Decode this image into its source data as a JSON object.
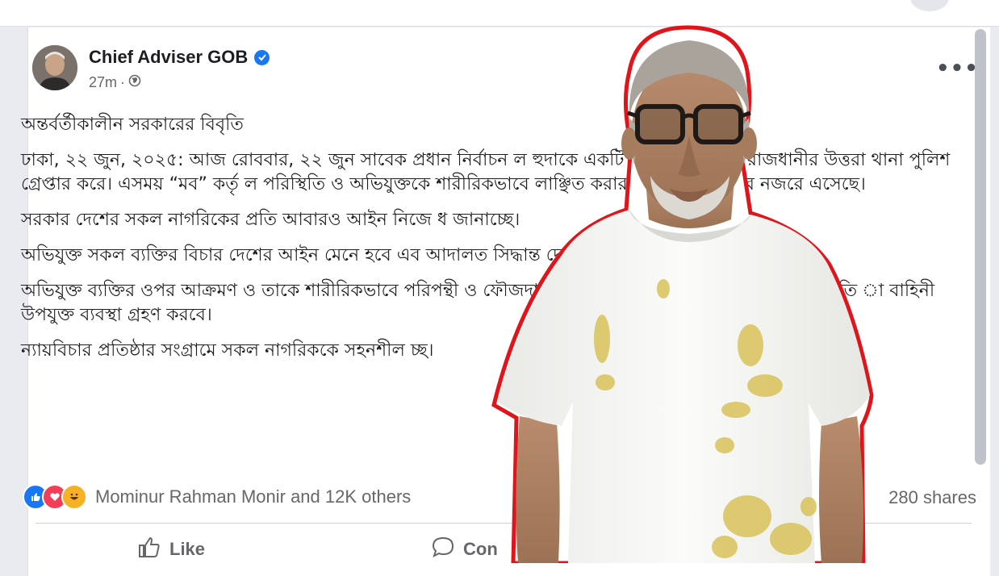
{
  "post": {
    "author": "Chief Adviser GOB",
    "time": "27m",
    "separator": "·",
    "body": [
      "অন্তর্বর্তীকালীন সরকারের বিবৃতি",
      "ঢাকা, ২২ জুন, ২০২৫: আজ রোববার, ২২ জুন সাবেক প্রধান নির্বাচন ল হুদাকে একটি সুনির্দিষ্ট মামলায় রাজধানীর উত্তরা থানা পুলিশ গ্রেপ্তার করে। এসময় “মব” কর্তৃ ল পরিস্থিতি ও অভিযুক্তকে শারীরিকভাবে লাঞ্ছিত করার বিষয়টি সরকারের নজরে এসেছে।",
      "সরকার দেশের সকল নাগরিকের প্রতি আবারও আইন নিজে ধ জানাচ্ছে।",
      "অভিযুক্ত সকল ব্যক্তির বিচার দেশের আইন মেনে হবে এব আদালত সিদ্ধান্ত দেবেন।",
      "অভিযুক্ত ব্যক্তির ওপর আক্রমণ ও তাকে শারীরিকভাবে পরিপন্থী ও ফৌজদারি অপরাধ। “মব” সৃষ্টি করে উশৃঙ্খল পরিস্থিতি া বাহিনী উপযুক্ত ব্যবস্থা গ্রহণ করবে।",
      "ন্যায়বিচার প্রতিষ্ঠার সংগ্রামে সকল নাগরিককে সহনশীল চ্ছ।"
    ],
    "reactions_text": "Mominur Rahman Monir and 12K others",
    "shares_text": "280 shares",
    "actions": {
      "like": "Like",
      "comment": "Con"
    }
  },
  "colors": {
    "accent": "#1877f2",
    "text": "#1c1e21",
    "secondary": "#65676b",
    "outline": "#e0141b"
  },
  "icons": [
    "verified-icon",
    "globe-icon",
    "more-icon",
    "like-reaction-icon",
    "love-reaction-icon",
    "haha-reaction-icon",
    "like-icon",
    "comment-icon"
  ]
}
